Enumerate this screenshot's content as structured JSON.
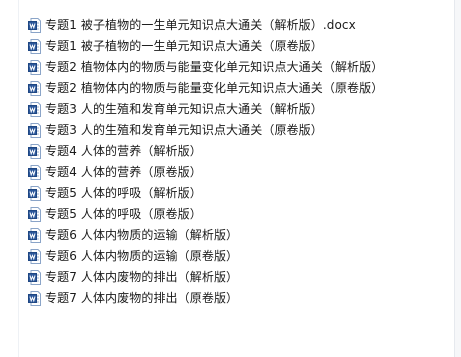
{
  "files": [
    {
      "name": "专题1 被子植物的一生单元知识点大通关（解析版）.docx",
      "icon": "word-doc-icon"
    },
    {
      "name": "专题1 被子植物的一生单元知识点大通关（原卷版）",
      "icon": "word-doc-icon"
    },
    {
      "name": "专题2 植物体内的物质与能量变化单元知识点大通关（解析版）",
      "icon": "word-doc-icon"
    },
    {
      "name": "专题2 植物体内的物质与能量变化单元知识点大通关（原卷版）",
      "icon": "word-doc-icon"
    },
    {
      "name": "专题3 人的生殖和发育单元知识点大通关（解析版）",
      "icon": "word-doc-icon"
    },
    {
      "name": "专题3 人的生殖和发育单元知识点大通关（原卷版）",
      "icon": "word-doc-icon"
    },
    {
      "name": "专题4 人体的营养（解析版）",
      "icon": "word-doc-icon"
    },
    {
      "name": "专题4 人体的营养（原卷版）",
      "icon": "word-doc-icon"
    },
    {
      "name": "专题5 人体的呼吸（解析版）",
      "icon": "word-doc-icon"
    },
    {
      "name": "专题5 人体的呼吸（原卷版）",
      "icon": "word-doc-icon"
    },
    {
      "name": "专题6 人体内物质的运输（解析版）",
      "icon": "word-doc-icon"
    },
    {
      "name": "专题6 人体内物质的运输（原卷版）",
      "icon": "word-doc-icon"
    },
    {
      "name": "专题7 人体内废物的排出（解析版）",
      "icon": "word-doc-icon"
    },
    {
      "name": "专题7 人体内废物的排出（原卷版）",
      "icon": "word-doc-icon"
    }
  ],
  "colors": {
    "icon_blue": "#2b579a",
    "icon_border": "#3b6fc0",
    "text": "#1a1a1a"
  }
}
